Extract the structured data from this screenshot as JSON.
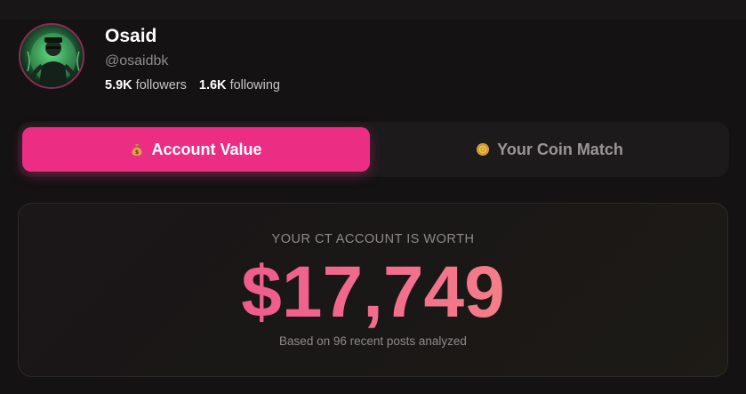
{
  "profile": {
    "display_name": "Osaid",
    "handle": "@osaidbk",
    "followers_count": "5.9K",
    "followers_label": "followers",
    "following_count": "1.6K",
    "following_label": "following"
  },
  "tabs": [
    {
      "label": "Account Value",
      "icon": "money-bag-icon",
      "active": true
    },
    {
      "label": "Your Coin Match",
      "icon": "coin-icon",
      "active": false
    }
  ],
  "value_card": {
    "caption": "YOUR CT ACCOUNT IS WORTH",
    "value": "$17,749",
    "note": "Based on 96 recent posts analyzed"
  },
  "colors": {
    "accent": "#ec2d84",
    "background": "#141213",
    "value_gradient_start": "#ec3f8a",
    "value_gradient_end": "#f7a07f"
  }
}
